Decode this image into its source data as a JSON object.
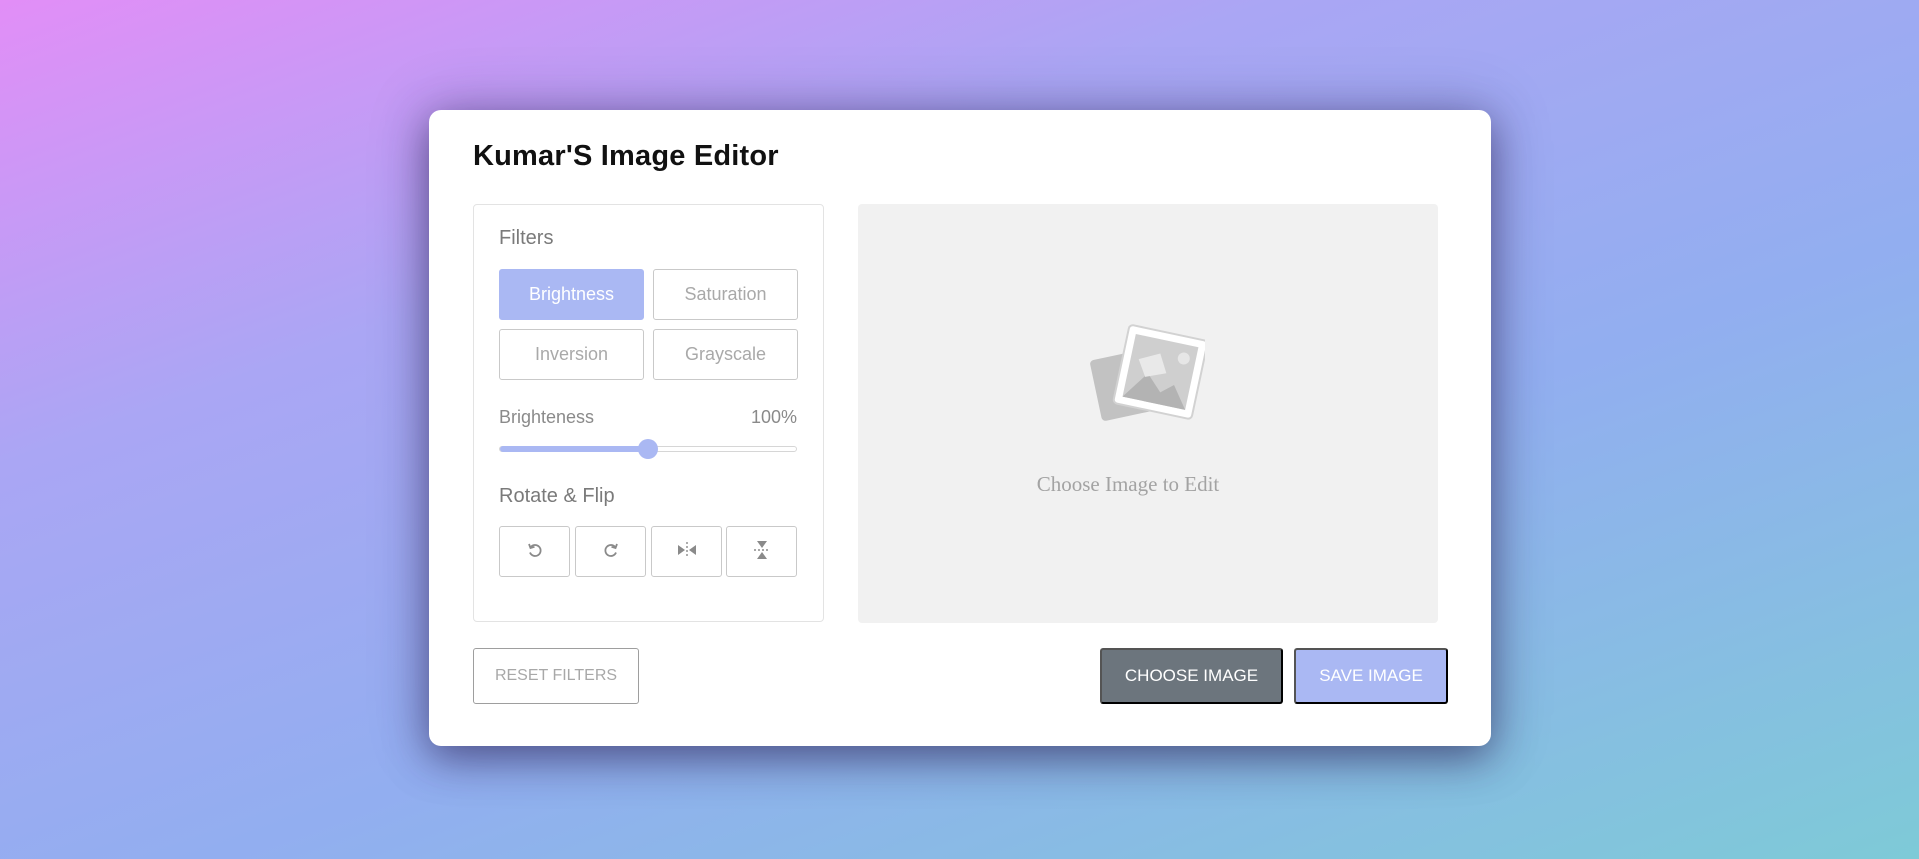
{
  "app": {
    "title": "Kumar'S Image Editor"
  },
  "filters": {
    "label": "Filters",
    "buttons": [
      {
        "label": "Brightness",
        "active": true
      },
      {
        "label": "Saturation",
        "active": false
      },
      {
        "label": "Inversion",
        "active": false
      },
      {
        "label": "Grayscale",
        "active": false
      }
    ]
  },
  "slider": {
    "name": "Brighteness",
    "value_text": "100%",
    "fraction": 0.5
  },
  "rotate": {
    "label": "Rotate & Flip",
    "buttons": [
      {
        "icon": "rotate-left-icon"
      },
      {
        "icon": "rotate-right-icon"
      },
      {
        "icon": "flip-horizontal-icon"
      },
      {
        "icon": "flip-vertical-icon"
      }
    ]
  },
  "preview": {
    "placeholder_text": "Choose Image to Edit",
    "icon": "image-placeholder-icon"
  },
  "actions": {
    "reset_label": "RESET FILTERS",
    "choose_label": "CHOOSE IMAGE",
    "save_label": "SAVE IMAGE"
  },
  "colors": {
    "accent": "#aab8f3",
    "choose_button": "#6c757d",
    "preview_bg": "#f1f1f1"
  }
}
